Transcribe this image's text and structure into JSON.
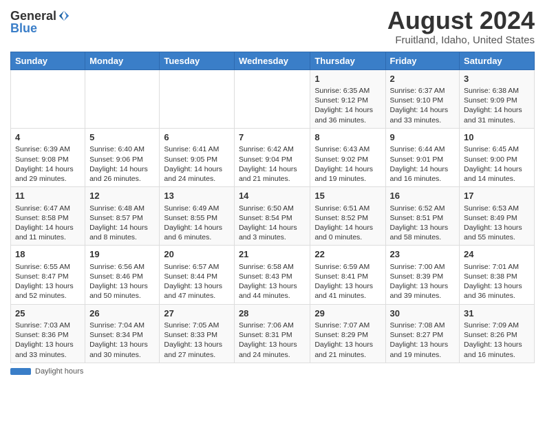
{
  "header": {
    "logo_general": "General",
    "logo_blue": "Blue",
    "month_title": "August 2024",
    "location": "Fruitland, Idaho, United States"
  },
  "days_of_week": [
    "Sunday",
    "Monday",
    "Tuesday",
    "Wednesday",
    "Thursday",
    "Friday",
    "Saturday"
  ],
  "footer": {
    "daylight_label": "Daylight hours"
  },
  "weeks": [
    [
      {
        "day": "",
        "info": ""
      },
      {
        "day": "",
        "info": ""
      },
      {
        "day": "",
        "info": ""
      },
      {
        "day": "",
        "info": ""
      },
      {
        "day": "1",
        "info": "Sunrise: 6:35 AM\nSunset: 9:12 PM\nDaylight: 14 hours and 36 minutes."
      },
      {
        "day": "2",
        "info": "Sunrise: 6:37 AM\nSunset: 9:10 PM\nDaylight: 14 hours and 33 minutes."
      },
      {
        "day": "3",
        "info": "Sunrise: 6:38 AM\nSunset: 9:09 PM\nDaylight: 14 hours and 31 minutes."
      }
    ],
    [
      {
        "day": "4",
        "info": "Sunrise: 6:39 AM\nSunset: 9:08 PM\nDaylight: 14 hours and 29 minutes."
      },
      {
        "day": "5",
        "info": "Sunrise: 6:40 AM\nSunset: 9:06 PM\nDaylight: 14 hours and 26 minutes."
      },
      {
        "day": "6",
        "info": "Sunrise: 6:41 AM\nSunset: 9:05 PM\nDaylight: 14 hours and 24 minutes."
      },
      {
        "day": "7",
        "info": "Sunrise: 6:42 AM\nSunset: 9:04 PM\nDaylight: 14 hours and 21 minutes."
      },
      {
        "day": "8",
        "info": "Sunrise: 6:43 AM\nSunset: 9:02 PM\nDaylight: 14 hours and 19 minutes."
      },
      {
        "day": "9",
        "info": "Sunrise: 6:44 AM\nSunset: 9:01 PM\nDaylight: 14 hours and 16 minutes."
      },
      {
        "day": "10",
        "info": "Sunrise: 6:45 AM\nSunset: 9:00 PM\nDaylight: 14 hours and 14 minutes."
      }
    ],
    [
      {
        "day": "11",
        "info": "Sunrise: 6:47 AM\nSunset: 8:58 PM\nDaylight: 14 hours and 11 minutes."
      },
      {
        "day": "12",
        "info": "Sunrise: 6:48 AM\nSunset: 8:57 PM\nDaylight: 14 hours and 8 minutes."
      },
      {
        "day": "13",
        "info": "Sunrise: 6:49 AM\nSunset: 8:55 PM\nDaylight: 14 hours and 6 minutes."
      },
      {
        "day": "14",
        "info": "Sunrise: 6:50 AM\nSunset: 8:54 PM\nDaylight: 14 hours and 3 minutes."
      },
      {
        "day": "15",
        "info": "Sunrise: 6:51 AM\nSunset: 8:52 PM\nDaylight: 14 hours and 0 minutes."
      },
      {
        "day": "16",
        "info": "Sunrise: 6:52 AM\nSunset: 8:51 PM\nDaylight: 13 hours and 58 minutes."
      },
      {
        "day": "17",
        "info": "Sunrise: 6:53 AM\nSunset: 8:49 PM\nDaylight: 13 hours and 55 minutes."
      }
    ],
    [
      {
        "day": "18",
        "info": "Sunrise: 6:55 AM\nSunset: 8:47 PM\nDaylight: 13 hours and 52 minutes."
      },
      {
        "day": "19",
        "info": "Sunrise: 6:56 AM\nSunset: 8:46 PM\nDaylight: 13 hours and 50 minutes."
      },
      {
        "day": "20",
        "info": "Sunrise: 6:57 AM\nSunset: 8:44 PM\nDaylight: 13 hours and 47 minutes."
      },
      {
        "day": "21",
        "info": "Sunrise: 6:58 AM\nSunset: 8:43 PM\nDaylight: 13 hours and 44 minutes."
      },
      {
        "day": "22",
        "info": "Sunrise: 6:59 AM\nSunset: 8:41 PM\nDaylight: 13 hours and 41 minutes."
      },
      {
        "day": "23",
        "info": "Sunrise: 7:00 AM\nSunset: 8:39 PM\nDaylight: 13 hours and 39 minutes."
      },
      {
        "day": "24",
        "info": "Sunrise: 7:01 AM\nSunset: 8:38 PM\nDaylight: 13 hours and 36 minutes."
      }
    ],
    [
      {
        "day": "25",
        "info": "Sunrise: 7:03 AM\nSunset: 8:36 PM\nDaylight: 13 hours and 33 minutes."
      },
      {
        "day": "26",
        "info": "Sunrise: 7:04 AM\nSunset: 8:34 PM\nDaylight: 13 hours and 30 minutes."
      },
      {
        "day": "27",
        "info": "Sunrise: 7:05 AM\nSunset: 8:33 PM\nDaylight: 13 hours and 27 minutes."
      },
      {
        "day": "28",
        "info": "Sunrise: 7:06 AM\nSunset: 8:31 PM\nDaylight: 13 hours and 24 minutes."
      },
      {
        "day": "29",
        "info": "Sunrise: 7:07 AM\nSunset: 8:29 PM\nDaylight: 13 hours and 21 minutes."
      },
      {
        "day": "30",
        "info": "Sunrise: 7:08 AM\nSunset: 8:27 PM\nDaylight: 13 hours and 19 minutes."
      },
      {
        "day": "31",
        "info": "Sunrise: 7:09 AM\nSunset: 8:26 PM\nDaylight: 13 hours and 16 minutes."
      }
    ]
  ]
}
